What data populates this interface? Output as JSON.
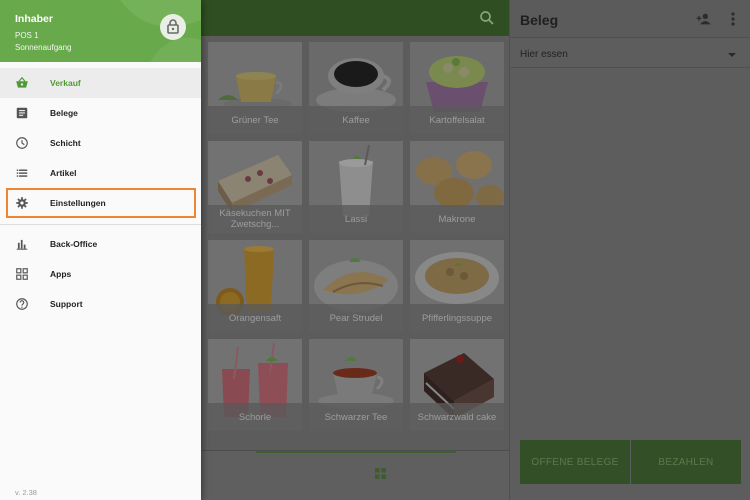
{
  "drawer": {
    "user_name": "Inhaber",
    "pos_name": "POS 1",
    "shift_name": "Sonnenaufgang",
    "items": [
      {
        "label": "Verkauf",
        "icon": "basket-icon",
        "active": true
      },
      {
        "label": "Belege",
        "icon": "receipt-icon"
      },
      {
        "label": "Schicht",
        "icon": "clock-icon"
      },
      {
        "label": "Artikel",
        "icon": "list-icon"
      },
      {
        "label": "Einstellungen",
        "icon": "gear-icon",
        "highlighted": true
      },
      {
        "label": "Back-Office",
        "icon": "bar-chart-icon"
      },
      {
        "label": "Apps",
        "icon": "apps-icon"
      },
      {
        "label": "Support",
        "icon": "help-icon"
      }
    ],
    "version": "v. 2.38"
  },
  "products": [
    {
      "name": "Grüner Tee"
    },
    {
      "name": "Kaffee"
    },
    {
      "name": "Kartoffelsalat"
    },
    {
      "name": "Käsekuchen MIT Zwetschg..."
    },
    {
      "name": "Lassi"
    },
    {
      "name": "Makrone"
    },
    {
      "name": "Orangensaft"
    },
    {
      "name": "Pear Strudel"
    },
    {
      "name": "Pfifferlingssuppe"
    },
    {
      "name": "Schorle"
    },
    {
      "name": "Schwarzer Tee"
    },
    {
      "name": "Schwarzwald cake"
    }
  ],
  "ticket": {
    "title": "Beleg",
    "dining_option": "Hier essen",
    "open_tickets_label": "OFFENE BELEGE",
    "pay_label": "BEZAHLEN"
  },
  "colors": {
    "brand_green": "#68a94c",
    "highlight_orange": "#ef8431"
  }
}
